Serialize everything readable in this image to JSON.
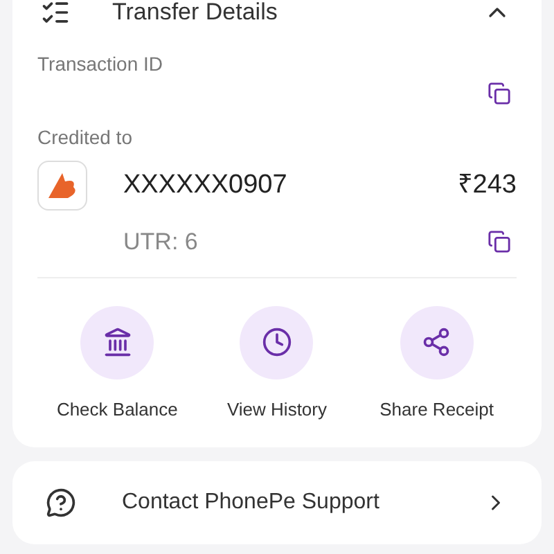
{
  "transfer_details": {
    "title": "Transfer Details",
    "expanded": true,
    "transaction_id": {
      "label": "Transaction ID"
    },
    "credited_to": {
      "label": "Credited to",
      "account": "XXXXXX0907",
      "amount": "₹243",
      "utr": "UTR: 6"
    }
  },
  "actions": [
    {
      "kind": "bank",
      "label": "Check Balance"
    },
    {
      "kind": "history",
      "label": "View History"
    },
    {
      "kind": "share",
      "label": "Share Receipt"
    }
  ],
  "support": {
    "label": "Contact PhonePe Support"
  }
}
